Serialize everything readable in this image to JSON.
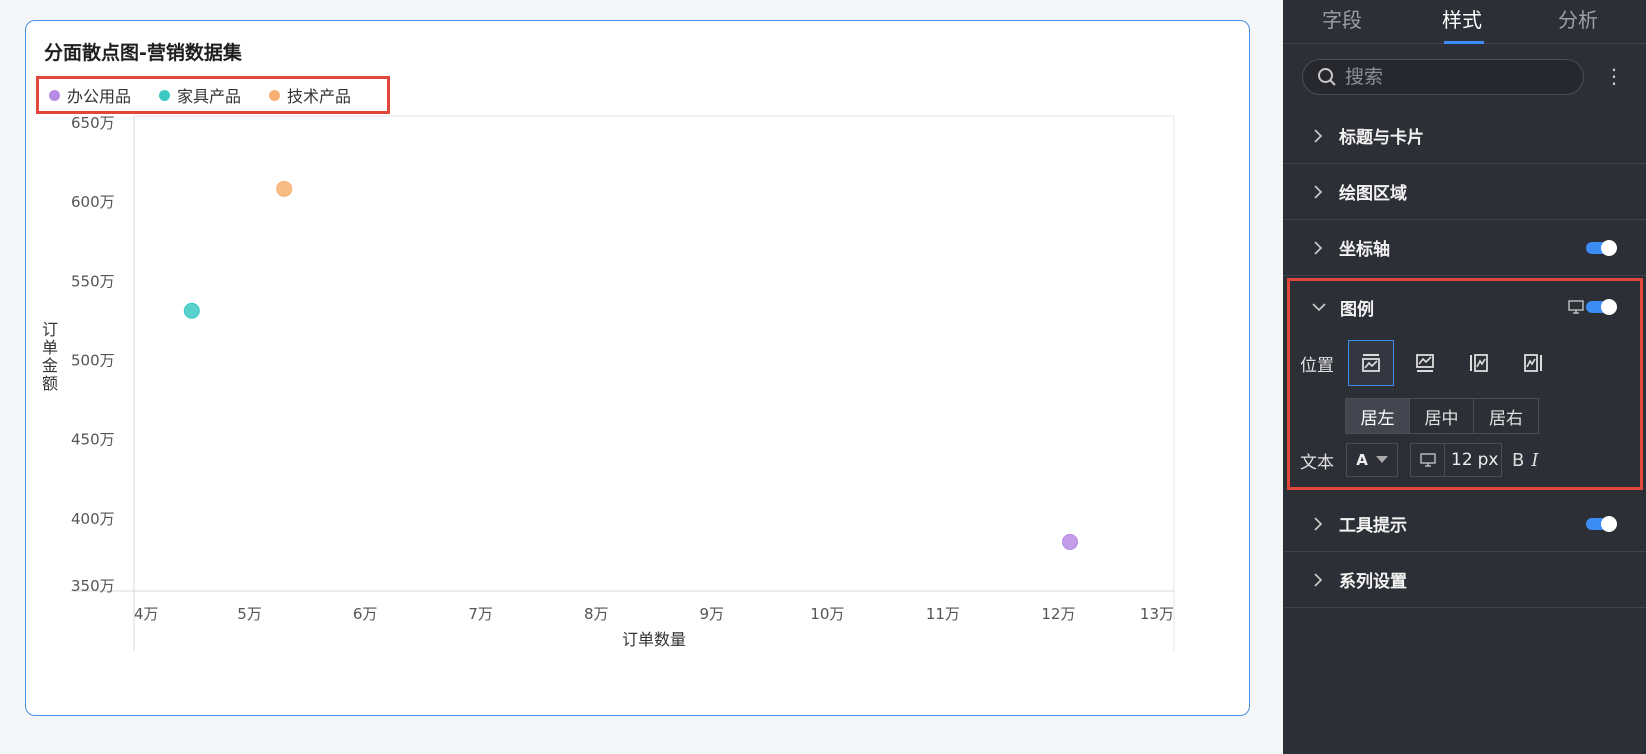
{
  "chart": {
    "title": "分面散点图-营销数据集",
    "legend": [
      {
        "label": "办公用品",
        "color": "#b88be6"
      },
      {
        "label": "家具产品",
        "color": "#3cc9c3"
      },
      {
        "label": "技术产品",
        "color": "#f7b072"
      }
    ],
    "annotation": {
      "highlight_color": "#e2473b"
    }
  },
  "chart_data": {
    "type": "scatter",
    "title": "分面散点图-营销数据集",
    "xlabel": "订单数量",
    "ylabel": "订单金额",
    "x_ticks": [
      "4万",
      "5万",
      "6万",
      "7万",
      "8万",
      "9万",
      "10万",
      "11万",
      "12万",
      "13万"
    ],
    "y_ticks": [
      "650万",
      "600万",
      "550万",
      "500万",
      "450万",
      "400万",
      "350万"
    ],
    "xlim": [
      40000,
      130000
    ],
    "ylim": [
      3500000,
      6500000
    ],
    "series": [
      {
        "name": "办公用品",
        "color": "#b88be6",
        "points": [
          {
            "x": 121000,
            "y": 3810000
          }
        ]
      },
      {
        "name": "家具产品",
        "color": "#3cc9c3",
        "points": [
          {
            "x": 45000,
            "y": 5270000
          }
        ]
      },
      {
        "name": "技术产品",
        "color": "#f7b072",
        "points": [
          {
            "x": 53000,
            "y": 6040000
          }
        ]
      }
    ],
    "grid": false,
    "legend_position": "top-left"
  },
  "panel": {
    "tabs": [
      {
        "label": "字段",
        "active": false
      },
      {
        "label": "样式",
        "active": true
      },
      {
        "label": "分析",
        "active": false
      }
    ],
    "search_placeholder": "搜索",
    "sections": {
      "title_card": "标题与卡片",
      "plot_area": "绘图区域",
      "axis": "坐标轴",
      "legend": "图例",
      "tooltip": "工具提示",
      "series": "系列设置"
    },
    "legend_settings": {
      "position_label": "位置",
      "position_options": [
        "top",
        "bottom",
        "left",
        "right"
      ],
      "selected_position": "top",
      "align_options": [
        "居左",
        "居中",
        "居右"
      ],
      "selected_align": "居左",
      "text_label": "文本",
      "font_letter": "A",
      "font_size_value": "12",
      "font_size_unit": "px",
      "bold_label": "B",
      "italic_label": "I"
    },
    "toggles": {
      "axis": true,
      "legend": true,
      "tooltip": true
    }
  }
}
